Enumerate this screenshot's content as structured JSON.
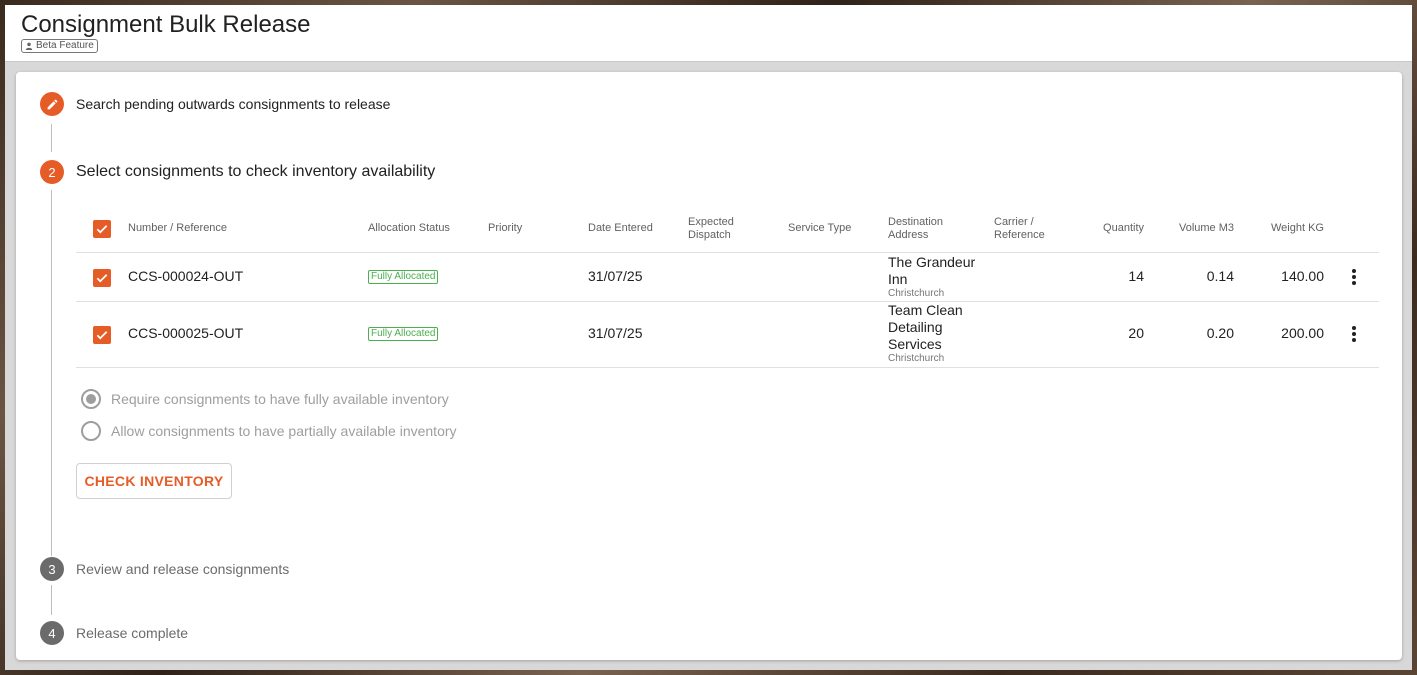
{
  "app": {
    "title": "Consignment Bulk Release",
    "badge": "Beta Feature"
  },
  "steps": [
    {
      "number": "",
      "label": "Search pending outwards consignments to release",
      "state": "completed",
      "icon": "pencil-icon"
    },
    {
      "number": "2",
      "label": "Select consignments to check inventory availability",
      "state": "active"
    },
    {
      "number": "3",
      "label": "Review and release consignments",
      "state": "inactive"
    },
    {
      "number": "4",
      "label": "Release complete",
      "state": "inactive"
    }
  ],
  "table": {
    "headers": {
      "number": "Number / Reference",
      "allocation": "Allocation Status",
      "priority": "Priority",
      "date_entered": "Date Entered",
      "expected_dispatch": "Expected Dispatch",
      "service_type": "Service Type",
      "destination": "Destination Address",
      "carrier": "Carrier / Reference",
      "quantity": "Quantity",
      "volume": "Volume M3",
      "weight": "Weight KG"
    },
    "rows": [
      {
        "checked": true,
        "number": "CCS-000024-OUT",
        "allocation": "Fully Allocated",
        "priority": "",
        "date_entered": "31/07/25",
        "expected_dispatch": "",
        "service_type": "",
        "destination_name": "The Grandeur Inn",
        "destination_city": "Christchurch",
        "carrier": "",
        "quantity": "14",
        "volume": "0.14",
        "weight": "140.00"
      },
      {
        "checked": true,
        "number": "CCS-000025-OUT",
        "allocation": "Fully Allocated",
        "priority": "",
        "date_entered": "31/07/25",
        "expected_dispatch": "",
        "service_type": "",
        "destination_name": "Team Clean Detailing Services",
        "destination_city": "Christchurch",
        "carrier": "",
        "quantity": "20",
        "volume": "0.20",
        "weight": "200.00"
      }
    ]
  },
  "options": {
    "require_full": "Require consignments to have fully available inventory",
    "allow_partial": "Allow consignments to have partially available inventory",
    "selected": "require_full"
  },
  "actions": {
    "check_inventory": "CHECK INVENTORY"
  },
  "colors": {
    "accent": "#e65c27",
    "success": "#4caf50",
    "inactive_step": "#6b6b6b"
  }
}
